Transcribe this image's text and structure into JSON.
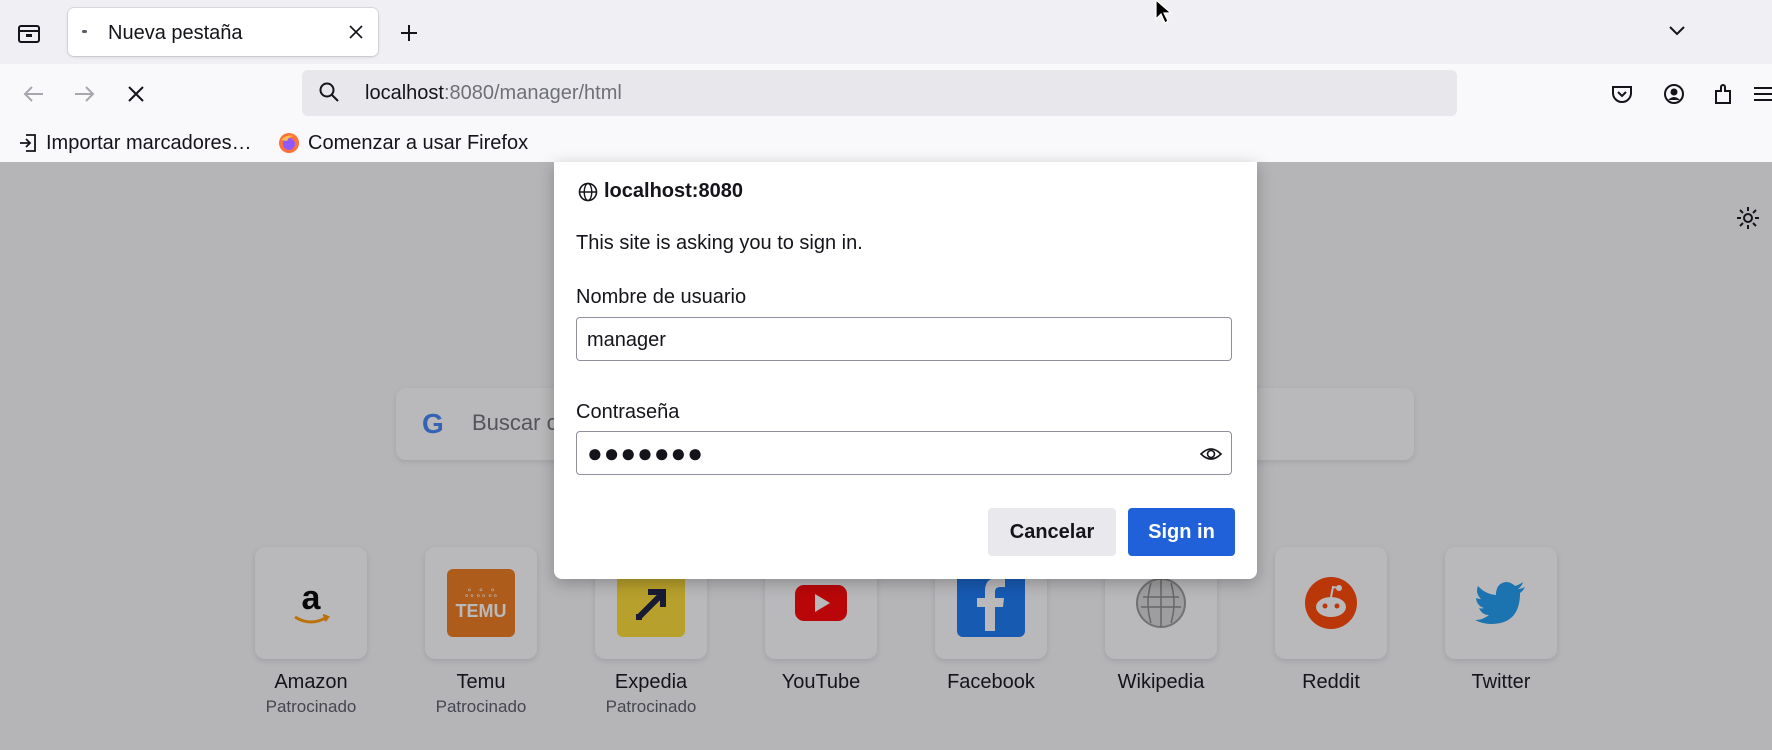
{
  "tab": {
    "title": "Nueva pestaña"
  },
  "navbar": {
    "url_host": "localhost",
    "url_rest": ":8080/manager/html"
  },
  "bookmarks": [
    {
      "label": "Importar marcadores…"
    },
    {
      "label": "Comenzar a usar Firefox"
    }
  ],
  "newtab": {
    "search_placeholder": "Buscar c",
    "sites": [
      {
        "name": "Amazon",
        "sponsor": "Patrocinado",
        "color": "#ffffff"
      },
      {
        "name": "Temu",
        "sponsor": "Patrocinado",
        "color": "#f07a1a"
      },
      {
        "name": "Expedia",
        "sponsor": "Patrocinado",
        "color": "#fddb32"
      },
      {
        "name": "YouTube",
        "sponsor": "",
        "color": "#ff0000"
      },
      {
        "name": "Facebook",
        "sponsor": "",
        "color": "#1877f2"
      },
      {
        "name": "Wikipedia",
        "sponsor": "",
        "color": "#ffffff"
      },
      {
        "name": "Reddit",
        "sponsor": "",
        "color": "#ff4500"
      },
      {
        "name": "Twitter",
        "sponsor": "",
        "color": "#1d9bf0"
      }
    ]
  },
  "dialog": {
    "origin": "localhost:8080",
    "message": "This site is asking you to sign in.",
    "username_label": "Nombre de usuario",
    "username_value": "manager",
    "password_label": "Contraseña",
    "password_value": "●●●●●●●",
    "cancel_label": "Cancelar",
    "signin_label": "Sign in"
  },
  "colors": {
    "accent": "#2060d8",
    "toolbar": "#f9f9fb",
    "tabstrip": "#f0f0f4"
  }
}
